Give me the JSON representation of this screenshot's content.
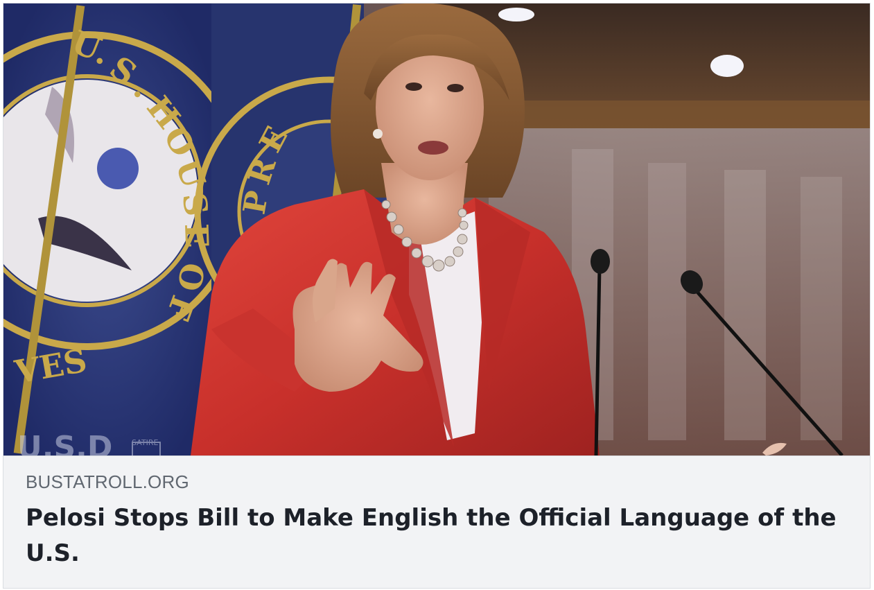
{
  "link_preview": {
    "domain": "BUSTATROLL.ORG",
    "headline": "Pelosi Stops Bill to Make English the Official Language of the U.S.",
    "image_alt": "Woman in red blazer speaking at podium with raised hand in front of U.S. House of Representatives flags",
    "flag_seal_lettering": "U.S. HOUSE OF REPRESENTATIVES",
    "watermark_text": "SATIRE"
  },
  "colors": {
    "card_background": "#f2f3f5",
    "domain_text": "#606770",
    "headline_text": "#1d2129",
    "border": "#dadde1"
  }
}
